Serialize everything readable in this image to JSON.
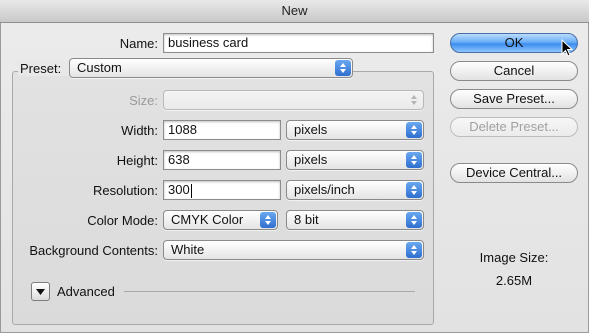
{
  "window": {
    "title": "New"
  },
  "name": {
    "label": "Name:",
    "value": "business card"
  },
  "preset": {
    "label": "Preset:",
    "value": "Custom"
  },
  "size": {
    "label": "Size:",
    "value": ""
  },
  "width": {
    "label": "Width:",
    "value": "1088",
    "unit": "pixels"
  },
  "height": {
    "label": "Height:",
    "value": "638",
    "unit": "pixels"
  },
  "resolution": {
    "label": "Resolution:",
    "value": "300",
    "unit": "pixels/inch"
  },
  "color_mode": {
    "label": "Color Mode:",
    "value": "CMYK Color",
    "depth": "8 bit"
  },
  "background": {
    "label": "Background Contents:",
    "value": "White"
  },
  "advanced": {
    "label": "Advanced"
  },
  "buttons": {
    "ok": "OK",
    "cancel": "Cancel",
    "save_preset": "Save Preset...",
    "delete_preset": "Delete Preset...",
    "device_central": "Device Central..."
  },
  "image_size": {
    "label": "Image Size:",
    "value": "2.65M"
  },
  "colors": {
    "accent": "#3c8df0",
    "window": "#e6e6e6"
  }
}
